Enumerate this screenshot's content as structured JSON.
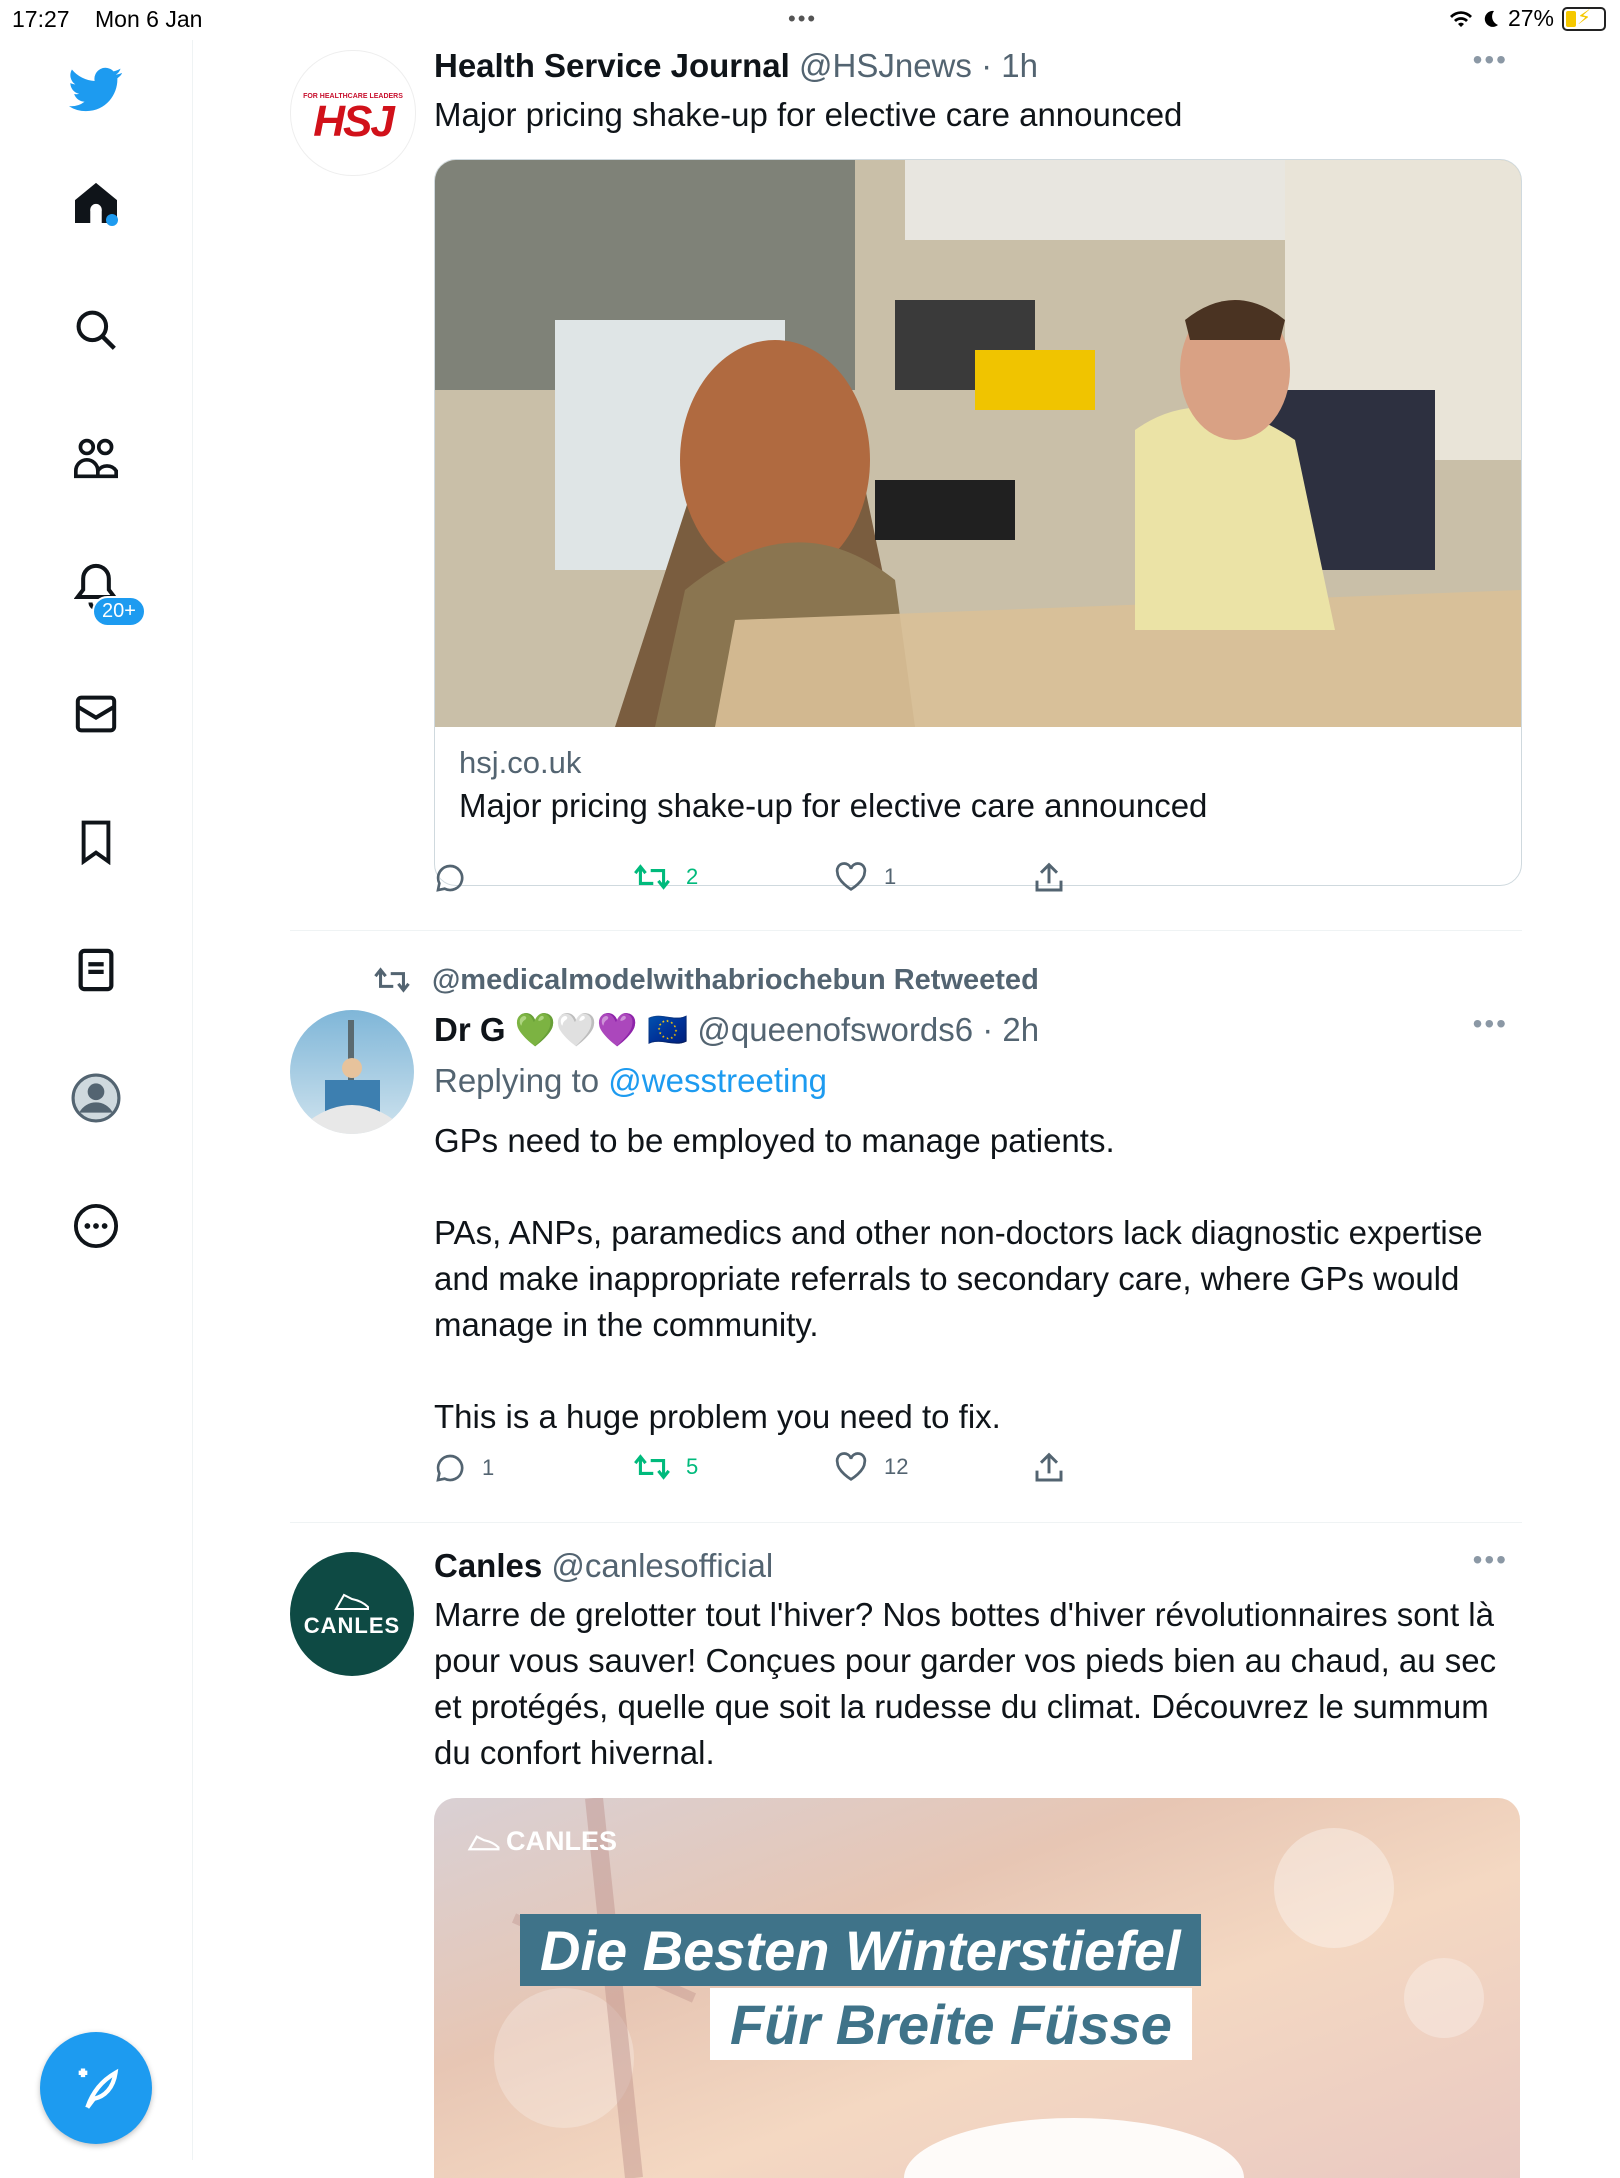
{
  "status_bar": {
    "time": "17:27",
    "date": "Mon 6 Jan",
    "battery": "27%"
  },
  "sidebar": {
    "items": [
      {
        "name": "twitter-logo"
      },
      {
        "name": "home"
      },
      {
        "name": "explore"
      },
      {
        "name": "communities"
      },
      {
        "name": "notifications"
      },
      {
        "name": "messages"
      },
      {
        "name": "bookmarks"
      },
      {
        "name": "lists"
      },
      {
        "name": "profile"
      },
      {
        "name": "more"
      }
    ],
    "notifications_badge": "20+"
  },
  "tweets": [
    {
      "author": "Health Service Journal",
      "handle": "@HSJnews",
      "time": "· 1h",
      "avatar_text": "HSJ",
      "avatar_caption": "FOR HEALTHCARE LEADERS",
      "text": "Major pricing shake-up for elective care announced",
      "card": {
        "domain": "hsj.co.uk",
        "title": "Major pricing shake-up for elective care announced"
      },
      "actions": {
        "replies": "",
        "retweets": "2",
        "likes": "1"
      }
    },
    {
      "retweeted_by": "@medicalmodelwithabriochebun Retweeted",
      "author": "Dr G",
      "author_emoji": "💚🤍💜 🇪🇺",
      "handle": "@queenofswords6",
      "time": "· 2h",
      "replying_label": "Replying to",
      "replying_to": "@wesstreeting",
      "paragraphs": [
        "GPs need to be employed to manage patients.",
        "PAs, ANPs, paramedics and other non-doctors lack diagnostic expertise and make inappropriate referrals to secondary care, where GPs would manage in the community.",
        "This is a huge problem you need to fix."
      ],
      "actions": {
        "replies": "1",
        "retweets": "5",
        "likes": "12"
      }
    },
    {
      "author": "Canles",
      "handle": "@canlesofficial",
      "avatar_text": "CANLES",
      "text": "Marre de grelotter tout l'hiver? Nos bottes d'hiver révolutionnaires sont là pour vous sauver! Conçues pour garder vos pieds bien au chaud, au sec et protégés, quelle que soit la rudesse du climat. Découvrez le summum du confort hivernal.",
      "promo": {
        "brand": "CANLES",
        "line1": "Die Besten Winterstiefel",
        "line2": "Für Breite Füsse"
      }
    }
  ],
  "colors": {
    "accent": "#1d9bf0",
    "retweet": "#00ba7c",
    "muted": "#536471",
    "canles_green": "#0e4a44"
  }
}
